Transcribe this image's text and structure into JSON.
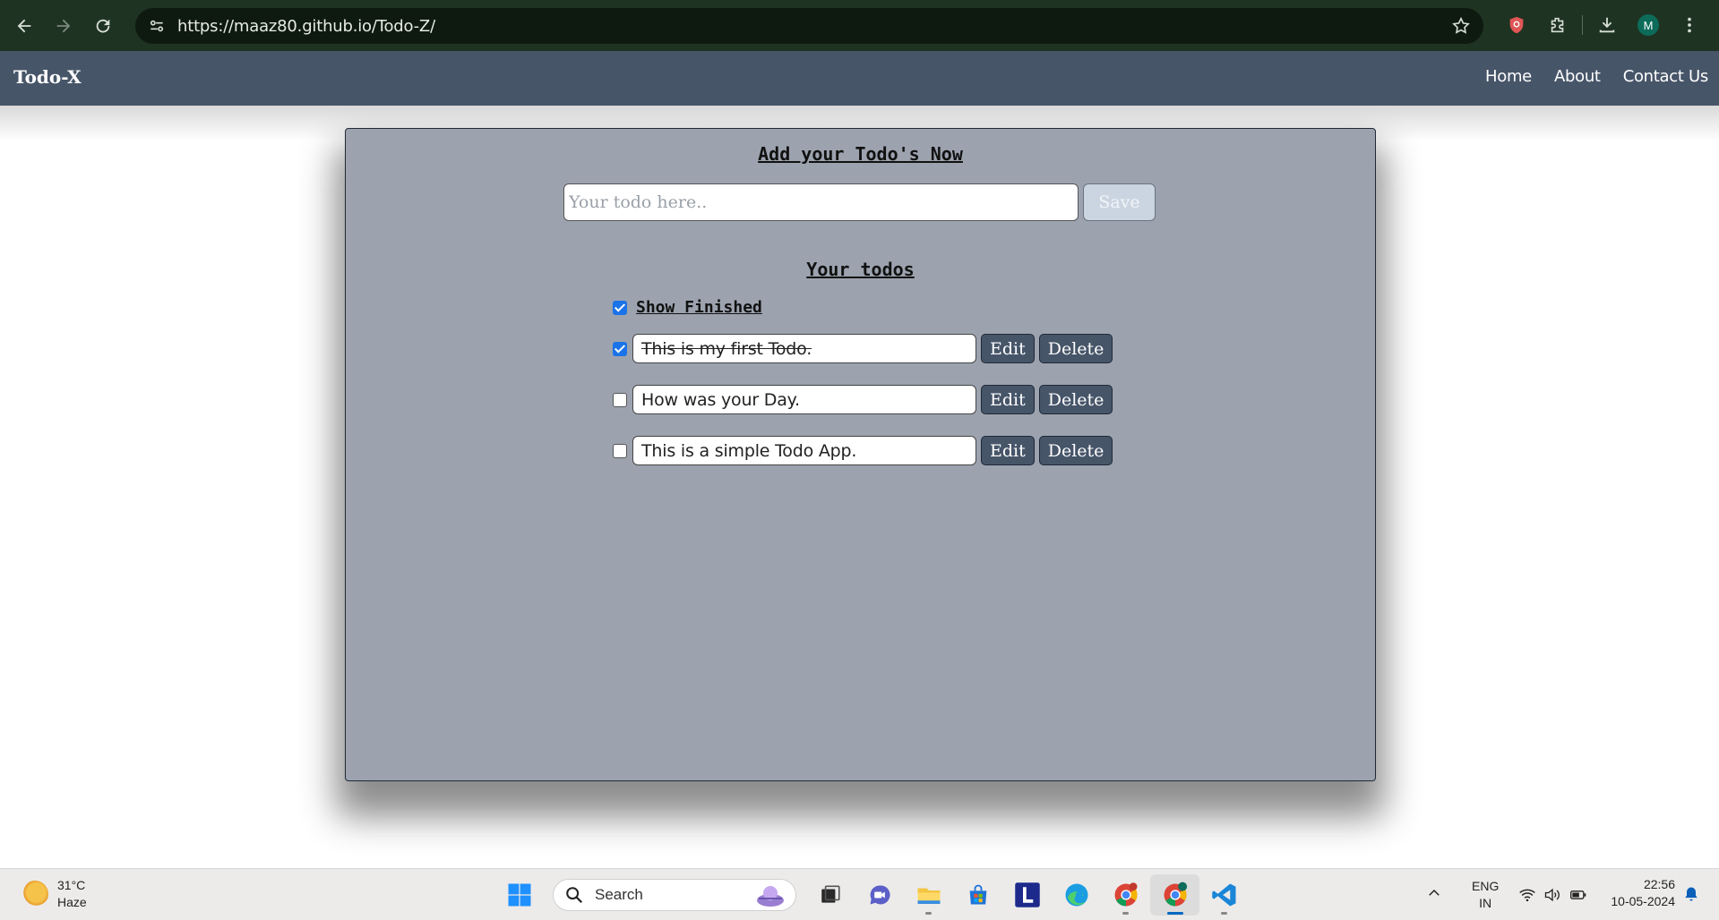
{
  "browser": {
    "url": "https://maaz80.github.io/Todo-Z/",
    "profile_initial": "M",
    "icons": [
      "back-icon",
      "forward-icon",
      "reload-icon",
      "site-info-icon",
      "star-icon",
      "shield-extension-icon",
      "extensions-icon",
      "download-icon",
      "profile-avatar",
      "more-menu-icon"
    ]
  },
  "navbar": {
    "brand": "Todo-X",
    "links": [
      "Home",
      "About",
      "Contact Us"
    ],
    "bg_color": "#475569"
  },
  "main": {
    "title": "Add your Todo's Now",
    "input_placeholder": "Your todo here..",
    "input_value": "",
    "save_label": "Save",
    "section_title": "Your todos",
    "show_finished_label": "Show Finished",
    "show_finished_checked": true,
    "todos": [
      {
        "text": "This is my first Todo.",
        "done": true
      },
      {
        "text": "How was your Day.",
        "done": false
      },
      {
        "text": "This is a simple Todo App.",
        "done": false
      }
    ],
    "edit_label": "Edit",
    "delete_label": "Delete",
    "card_color": "#9ca3af"
  },
  "taskbar": {
    "temperature": "31°C",
    "weather": "Haze",
    "search_label": "Search",
    "lang_line1": "ENG",
    "lang_line2": "IN",
    "time": "22:56",
    "date": "10-05-2024",
    "apps": [
      "windows-start-icon",
      "search",
      "copilot-icon",
      "task-view-icon",
      "teams-chat-icon",
      "file-explorer-icon",
      "ms-store-icon",
      "l-app-icon",
      "edge-icon",
      "chrome-icon",
      "chrome-profile-icon",
      "vscode-icon"
    ]
  }
}
